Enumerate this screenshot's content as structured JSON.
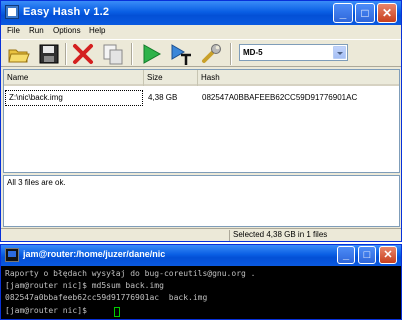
{
  "easyhash": {
    "title": "Easy Hash v 1.2",
    "menu": [
      "File",
      "Run",
      "Options",
      "Help"
    ],
    "toolbar_icons": [
      "open-folder-icon",
      "save-icon",
      "delete-icon",
      "copy-icon",
      "play-icon",
      "run-text-icon",
      "settings-wrench-icon"
    ],
    "algorithm": "MD-5",
    "columns": [
      "Name",
      "Size",
      "Hash"
    ],
    "rows": [
      {
        "name": "Z:\\nic\\back.img",
        "size": "4,38 GB",
        "hash": "082547A0BBAFEEB62CC59D91776901AC"
      }
    ],
    "log": "All 3 files are ok.",
    "status": "Selected 4,38 GB in 1 files"
  },
  "terminal": {
    "title": "jam@router:/home/juzer/dane/nic",
    "lines": [
      "Raporty o błędach wysyłaj do bug-coreutils@gnu.org .",
      "[jam@router nic]$ md5sum back.img",
      "082547a0bbafeeb62cc59d91776901ac  back.img",
      "[jam@router nic]$ "
    ]
  },
  "colors": {
    "titlebar": "#0a5fe4",
    "window_bg": "#ece9d8",
    "terminal_bg": "#000000",
    "terminal_fg": "#c0c0c0",
    "close_button": "#c8401e"
  }
}
